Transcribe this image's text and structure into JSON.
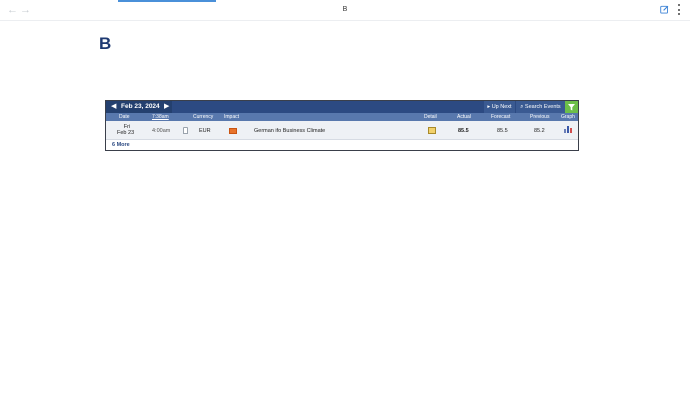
{
  "browser": {
    "back_glyph": "←",
    "forward_glyph": "→",
    "page_title": "B"
  },
  "heading": "B",
  "calendar": {
    "date": "Feb 23, 2024",
    "up_next": "Up Next",
    "search_events": "Search Events",
    "columns": {
      "date": "Date",
      "time": "7:38am",
      "currency": "Currency",
      "impact": "Impact",
      "detail": "Detail",
      "actual": "Actual",
      "forecast": "Forecast",
      "previous": "Previous",
      "graph": "Graph"
    },
    "rows": [
      {
        "day": "Fri",
        "date": "Feb 23",
        "time": "4:00am",
        "currency": "EUR",
        "event": "German ifo Business Climate",
        "actual": "85.5",
        "forecast": "85.5",
        "previous": "85.2",
        "impact_color": "#e8742c"
      }
    ],
    "more_link": "6 More"
  },
  "colors": {
    "header_bg": "#2c4a82",
    "columns_bg": "#5878ad",
    "filter_green": "#6cbf4a",
    "heading": "#1e3a72"
  }
}
